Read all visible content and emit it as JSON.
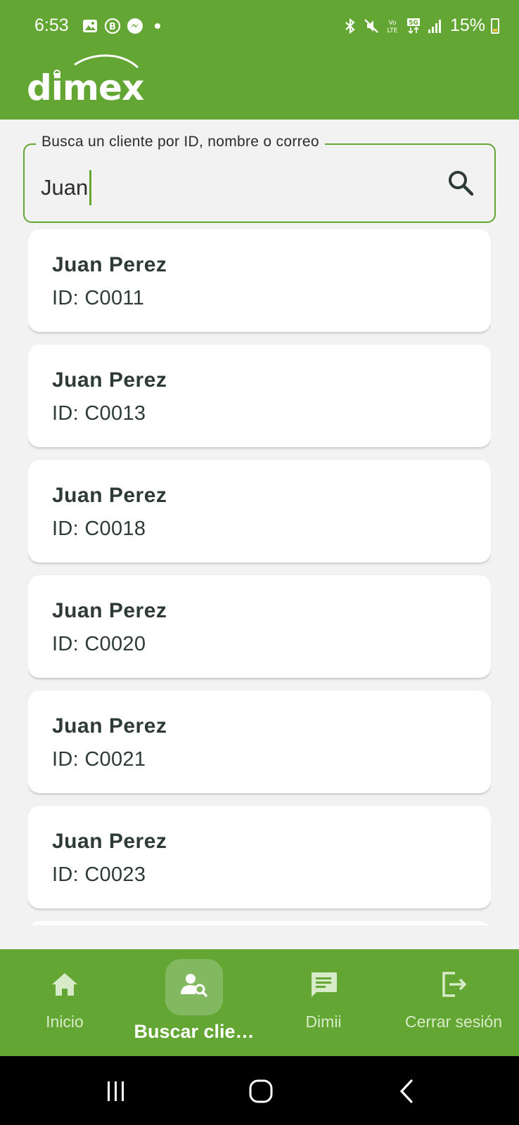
{
  "status_bar": {
    "time": "6:53",
    "battery": "15%",
    "left_icons": [
      "gallery-icon",
      "b-badge-icon",
      "messenger-icon",
      "dot-icon"
    ],
    "right_icons": [
      "bluetooth-icon",
      "mute-icon",
      "volte-icon",
      "5g-icon",
      "signal-icon",
      "battery-icon"
    ]
  },
  "header": {
    "logo_text": "dimex",
    "background_color": "#63a633"
  },
  "search": {
    "label": "Busca un cliente por ID, nombre o correo",
    "value": "Juan",
    "button_icon": "search-icon"
  },
  "results": [
    {
      "name": "Juan Perez",
      "id_text": "ID: C0011"
    },
    {
      "name": "Juan Perez",
      "id_text": "ID: C0013"
    },
    {
      "name": "Juan Perez",
      "id_text": "ID: C0018"
    },
    {
      "name": "Juan Perez",
      "id_text": "ID: C0020"
    },
    {
      "name": "Juan Perez",
      "id_text": "ID: C0021"
    },
    {
      "name": "Juan Perez",
      "id_text": "ID: C0023"
    }
  ],
  "bottom_nav": {
    "items": [
      {
        "label": "Inicio",
        "icon": "home-icon",
        "active": false
      },
      {
        "label": "Buscar clie…",
        "icon": "person-search-icon",
        "active": true
      },
      {
        "label": "Dimii",
        "icon": "chat-icon",
        "active": false
      },
      {
        "label": "Cerrar sesión",
        "icon": "logout-icon",
        "active": false
      }
    ]
  },
  "system_nav": {
    "icons": [
      "recent-apps-icon",
      "home-button-icon",
      "back-icon"
    ]
  },
  "colors": {
    "brand_green": "#63a633",
    "active_pill": "#81b860",
    "background": "#f2f2f2"
  }
}
